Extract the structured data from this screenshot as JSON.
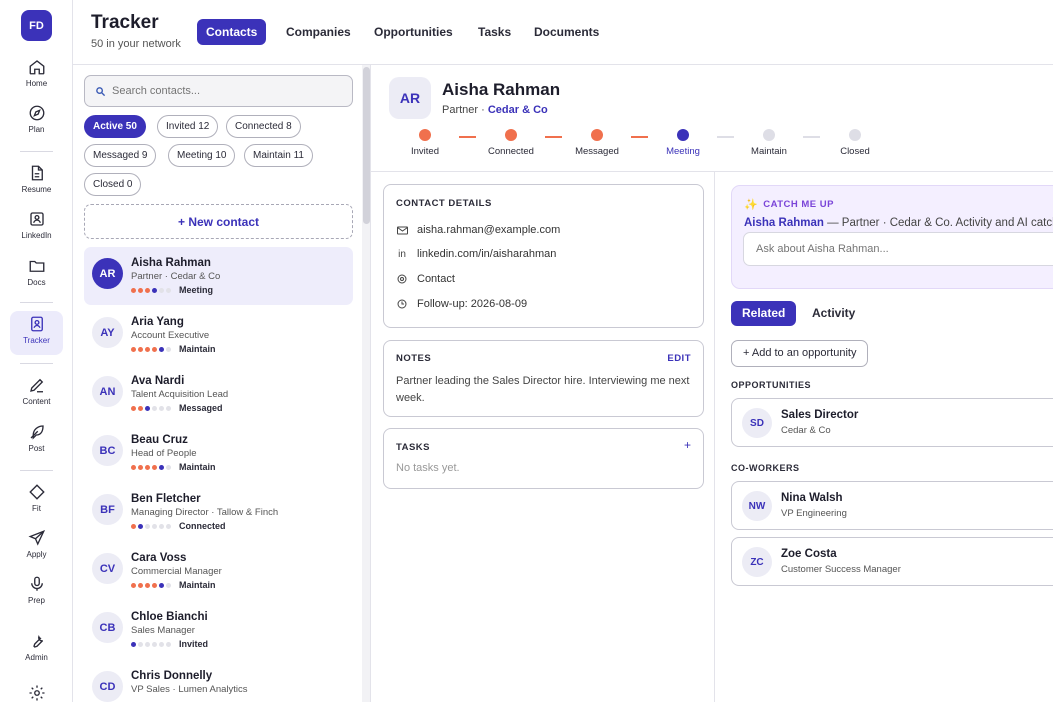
{
  "rail": {
    "logo": "FD",
    "items": [
      {
        "label": "Home",
        "icon": "home-icon"
      },
      {
        "label": "Plan",
        "icon": "compass-icon"
      },
      {
        "label": "Resume",
        "icon": "document-icon"
      },
      {
        "label": "LinkedIn",
        "icon": "linkedin-icon"
      },
      {
        "label": "Docs",
        "icon": "folder-icon"
      },
      {
        "label": "Tracker",
        "icon": "tracker-icon",
        "active": true
      },
      {
        "label": "Content",
        "icon": "pen-icon"
      },
      {
        "label": "Post",
        "icon": "feather-icon"
      },
      {
        "label": "Fit",
        "icon": "diamond-icon"
      },
      {
        "label": "Apply",
        "icon": "send-icon"
      },
      {
        "label": "Prep",
        "icon": "microphone-icon"
      },
      {
        "label": "Admin",
        "icon": "wrench-icon"
      }
    ]
  },
  "header": {
    "title": "Tracker",
    "subtitle": "50 in your network",
    "tabs": [
      "Contacts",
      "Companies",
      "Opportunities",
      "Tasks",
      "Documents"
    ],
    "active_tab": "Contacts"
  },
  "search": {
    "placeholder": "Search contacts..."
  },
  "filters": [
    "Active 50",
    "Invited 12",
    "Connected 8",
    "Messaged 9",
    "Meeting 10",
    "Maintain 11",
    "Closed 0"
  ],
  "new_contact_label": "+ New contact",
  "contacts": [
    {
      "initials": "AR",
      "name": "Aisha Rahman",
      "role": "Partner · Cedar & Co",
      "stage": "Meeting",
      "stage_index": 3
    },
    {
      "initials": "AY",
      "name": "Aria Yang",
      "role": "Account Executive",
      "stage": "Maintain",
      "stage_index": 4
    },
    {
      "initials": "AN",
      "name": "Ava Nardi",
      "role": "Talent Acquisition Lead",
      "stage": "Messaged",
      "stage_index": 2
    },
    {
      "initials": "BC",
      "name": "Beau Cruz",
      "role": "Head of People",
      "stage": "Maintain",
      "stage_index": 4
    },
    {
      "initials": "BF",
      "name": "Ben Fletcher",
      "role": "Managing Director · Tallow & Finch",
      "stage": "Connected",
      "stage_index": 1
    },
    {
      "initials": "CV",
      "name": "Cara Voss",
      "role": "Commercial Manager",
      "stage": "Maintain",
      "stage_index": 4
    },
    {
      "initials": "CB",
      "name": "Chloe Bianchi",
      "role": "Sales Manager",
      "stage": "Invited",
      "stage_index": 0
    },
    {
      "initials": "CD",
      "name": "Chris Donnelly",
      "role": "VP Sales · Lumen Analytics",
      "stage": "",
      "stage_index": -1
    }
  ],
  "detail": {
    "initials": "AR",
    "name": "Aisha Rahman",
    "role_prefix": "Partner · ",
    "company": "Cedar & Co",
    "pipeline": [
      "Invited",
      "Connected",
      "Messaged",
      "Meeting",
      "Maintain",
      "Closed"
    ],
    "pipeline_current": 3,
    "contact_details_title": "CONTACT DETAILS",
    "email": "aisha.rahman@example.com",
    "linkedin": "linkedin.com/in/aisharahman",
    "linkedin_prefix": "in",
    "type": "Contact",
    "followup": "Follow-up: 2026-08-09",
    "notes_title": "NOTES",
    "notes_edit": "EDIT",
    "notes_text": "Partner leading the Sales Director hire. Interviewing me next week.",
    "tasks_title": "TASKS",
    "tasks_add": "+",
    "tasks_empty": "No tasks yet."
  },
  "catchup": {
    "title": "CATCH ME UP",
    "name": "Aisha Rahman",
    "text": " — Partner · Cedar & Co. Activity and AI catch",
    "ask_placeholder": "Ask about Aisha Rahman..."
  },
  "related": {
    "tabs": [
      "Related",
      "Activity"
    ],
    "add_label": "+ Add to an opportunity",
    "opportunities_title": "OPPORTUNITIES",
    "opportunities": [
      {
        "initials": "SD",
        "name": "Sales Director",
        "sub": "Cedar & Co"
      }
    ],
    "coworkers_title": "CO-WORKERS",
    "coworkers": [
      {
        "initials": "NW",
        "name": "Nina Walsh",
        "sub": "VP Engineering"
      },
      {
        "initials": "ZC",
        "name": "Zoe Costa",
        "sub": "Customer Success Manager"
      }
    ]
  },
  "colors": {
    "accent": "#3b32b9",
    "done": "#f0704d",
    "pending": "#dedee6"
  }
}
